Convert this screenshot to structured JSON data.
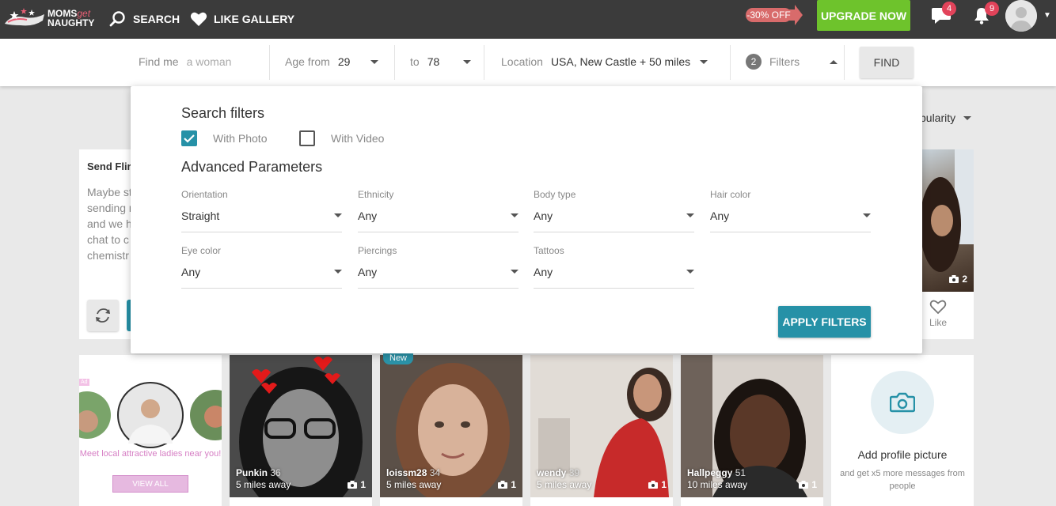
{
  "nav": {
    "logo_moms": "MOMS",
    "logo_get": "get",
    "logo_naughty": "NAUGHTY",
    "search": "SEARCH",
    "like_gallery": "LIKE GALLERY",
    "discount": "-30% OFF",
    "upgrade": "UPGRADE NOW",
    "messages_count": "4",
    "notifications_count": "9"
  },
  "searchbar": {
    "find_me_label": "Find me",
    "find_me_value": "a woman",
    "age_from_label": "Age from",
    "age_from_value": "29",
    "age_to_label": "to",
    "age_to_value": "78",
    "location_label": "Location",
    "location_value": "USA, New Castle + 50 miles",
    "filters_count": "2",
    "filters_label": "Filters",
    "find_button": "FIND"
  },
  "background": {
    "sort_label": "pularity",
    "flirt_title": "Send Flir",
    "flirt_lines": [
      "Maybe st",
      "sending r",
      "and we h",
      "chat to c",
      "chemistr"
    ],
    "side_photo_count": "2",
    "like_label": "Like",
    "ad_tag": "Ad",
    "ad_text": "Meet local attractive ladies near you!",
    "view_all": "VIEW ALL",
    "add_pic_title": "Add profile picture",
    "add_pic_sub": "and get x5 more messages from people",
    "profiles": [
      {
        "name": "Punkin",
        "age": "36",
        "distance": "5 miles away",
        "photos": "1",
        "is_new": false
      },
      {
        "name": "loissm28",
        "age": "34",
        "distance": "5 miles away",
        "photos": "1",
        "is_new": true,
        "new_label": "New"
      },
      {
        "name": "wendy",
        "age": "39",
        "distance": "5 miles away",
        "photos": "1",
        "is_new": false
      },
      {
        "name": "Hallpeggy",
        "age": "51",
        "distance": "10 miles away",
        "photos": "1",
        "is_new": false
      }
    ]
  },
  "filters": {
    "title": "Search filters",
    "with_photo": "With Photo",
    "with_photo_checked": true,
    "with_video": "With Video",
    "with_video_checked": false,
    "advanced_title": "Advanced Parameters",
    "fields": [
      {
        "label": "Orientation",
        "value": "Straight"
      },
      {
        "label": "Ethnicity",
        "value": "Any"
      },
      {
        "label": "Body type",
        "value": "Any"
      },
      {
        "label": "Hair color",
        "value": "Any"
      },
      {
        "label": "Eye color",
        "value": "Any"
      },
      {
        "label": "Piercings",
        "value": "Any"
      },
      {
        "label": "Tattoos",
        "value": "Any"
      }
    ],
    "apply_button": "APPLY FILTERS"
  },
  "colors": {
    "nav_bg": "#3b3b3b",
    "upgrade_green": "#6ec32c",
    "accent_teal": "#2691a7",
    "badge_red": "#e2435a",
    "discount_red": "#d86b6b"
  }
}
